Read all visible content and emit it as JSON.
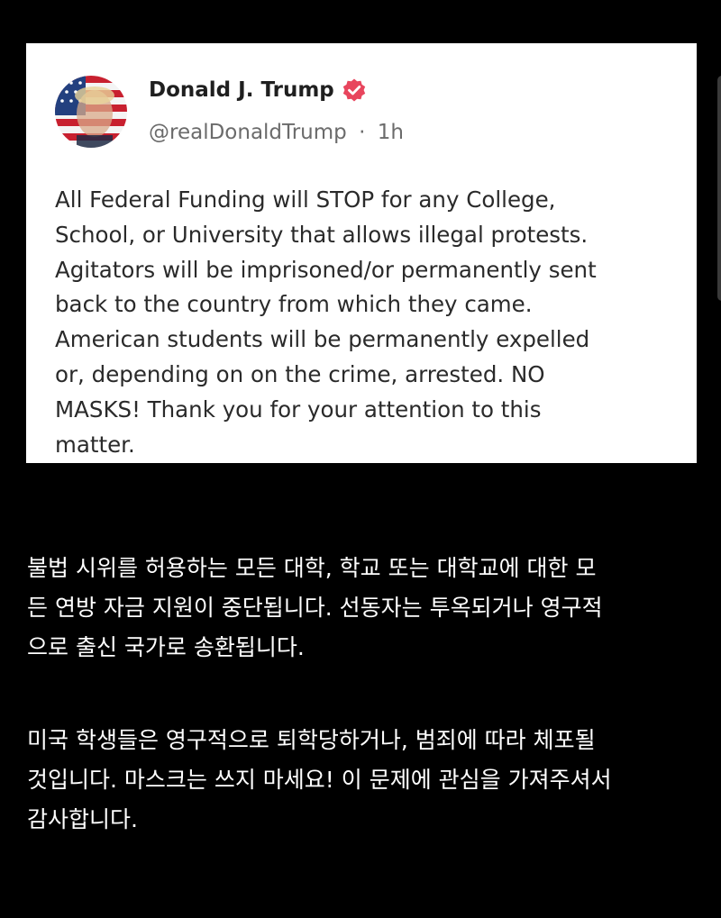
{
  "post": {
    "author_name": "Donald J. Trump",
    "handle": "@realDonaldTrump",
    "separator": "·",
    "timestamp": "1h",
    "body": "All Federal Funding will STOP for any College,\nSchool, or University that allows illegal protests.\nAgitators will be imprisoned/or permanently sent\nback to the country from which they came.\nAmerican students will be permanently expelled\nor, depending on on the crime, arrested. NO\nMASKS! Thank you for your attention to this\nmatter.",
    "avatar_icon": "portrait-flag-avatar",
    "verified_icon": "verified-badge-icon",
    "verified_color": "#e8455d"
  },
  "translation": {
    "paragraph_1": " 불법 시위를 허용하는 모든 대학, 학교 또는 대학교에 대한 모\n든 연방 자금 지원이 중단됩니다. 선동자는 투옥되거나 영구적\n으로 출신 국가로 송환됩니다.",
    "paragraph_2": "미국 학생들은 영구적으로 퇴학당하거나, 범죄에 따라 체포될\n것입니다. 마스크는 쓰지 마세요! 이 문제에 관심을 가져주셔서\n감사합니다."
  },
  "colors": {
    "background": "#000000",
    "card": "#ffffff",
    "text_dark": "#2a2a2a",
    "text_muted": "#6b6b6b",
    "text_light": "#ffffff"
  }
}
